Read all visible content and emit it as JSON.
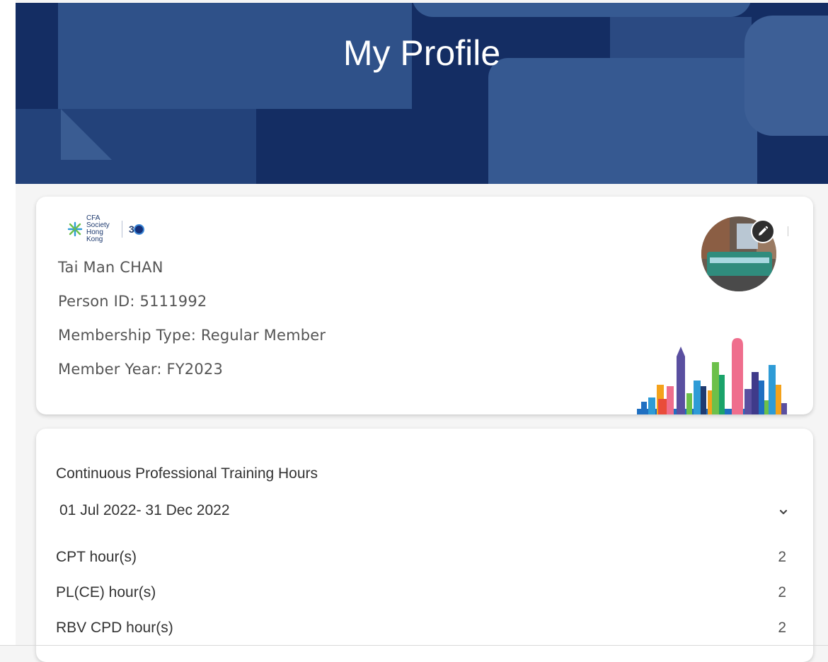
{
  "header": {
    "title": "My Profile"
  },
  "profile": {
    "logo": {
      "org_line1": "CFA Society",
      "org_line2": "Hong Kong",
      "anniversary": "3"
    },
    "name": "Tai Man CHAN",
    "person_id": "Person ID: 5111992",
    "membership_type": "Membership Type: Regular Member",
    "member_year": "Member Year: FY2023"
  },
  "cpt": {
    "title": "Continuous Professional Training Hours",
    "period": "01 Jul 2022- 31 Dec 2022",
    "rows": [
      {
        "label": "CPT hour(s)",
        "value": "2"
      },
      {
        "label": "PL(CE) hour(s)",
        "value": "2"
      },
      {
        "label": "RBV CPD hour(s)",
        "value": "2"
      }
    ]
  },
  "colors": {
    "header_bg": "#142d63",
    "card_bg": "#ffffff",
    "page_bg": "#f5f5f5",
    "text_muted": "#555555"
  },
  "icons": {
    "edit": "pencil-icon",
    "expand": "chevron-down-icon",
    "logo": "cfa-society-logo-icon",
    "skyline": "hong-kong-skyline-icon"
  }
}
